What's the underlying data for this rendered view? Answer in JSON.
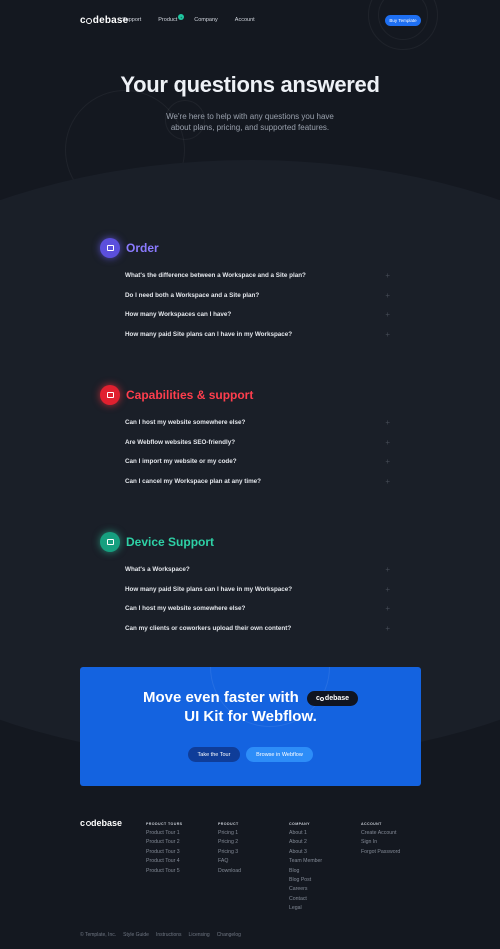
{
  "header": {
    "logo": {
      "pre": "c",
      "post": "debase"
    },
    "nav": [
      {
        "label": "Support"
      },
      {
        "label": "Product",
        "badge": "+"
      },
      {
        "label": "Company"
      },
      {
        "label": "Account"
      }
    ],
    "cta_label": "Buy Template"
  },
  "hero": {
    "title": "Your questions answered",
    "subtitle": "We're here to help with any questions you have about plans, pricing, and supported features."
  },
  "sections": [
    {
      "title": "Order",
      "color": "#8b7bff",
      "icon_bg": "#5b4fdc",
      "icon": "cart-icon",
      "questions": [
        "What's the difference between a Workspace and a Site plan?",
        "Do I need both a Workspace and a Site plan?",
        "How many Workspaces can I have?",
        "How many paid Site plans can I have in my Workspace?"
      ]
    },
    {
      "title": "Capabilities & support",
      "color": "#ff3e4d",
      "icon_bg": "#e0202f",
      "icon": "support-icon",
      "questions": [
        "Can I host my website somewhere else?",
        "Are Webflow websites SEO-friendly?",
        "Can I import my website or my code?",
        "Can I cancel my Workspace plan at any time?"
      ]
    },
    {
      "title": "Device Support",
      "color": "#2ed1a6",
      "icon_bg": "#169f7f",
      "icon": "device-icon",
      "questions": [
        "What's a Workspace?",
        "How many paid Site plans can I have in my Workspace?",
        "Can I host my website somewhere else?",
        "Can my clients or coworkers upload their own content?"
      ]
    }
  ],
  "cta": {
    "title_line1": "Move even faster with",
    "title_line2": "UI Kit for Webflow.",
    "pill_logo": {
      "pre": "c",
      "post": "debase"
    },
    "tour_label": "Take the Tour",
    "browse_label": "Browse in Webflow"
  },
  "footer": {
    "logo": {
      "pre": "c",
      "post": "debase"
    },
    "columns": [
      {
        "heading": "PRODUCT TOURS",
        "links": [
          "Product Tour 1",
          "Product Tour 2",
          "Product Tour 3",
          "Product Tour 4",
          "Product Tour 5"
        ]
      },
      {
        "heading": "PRODUCT",
        "links": [
          "Pricing 1",
          "Pricing 2",
          "Pricing 3",
          "FAQ",
          "Download"
        ]
      },
      {
        "heading": "COMPANY",
        "links": [
          "About 1",
          "About 2",
          "About 3",
          "Team Member",
          "Blog",
          "Blog Post",
          "Careers",
          "Contact",
          "Legal"
        ]
      },
      {
        "heading": "ACCOUNT",
        "links": [
          "Create Account",
          "Sign In",
          "Forgot Password"
        ]
      }
    ],
    "bottom_links": [
      "© Template, Inc.",
      "Style Guide",
      "Instructions",
      "Licensing",
      "Changelog"
    ]
  }
}
